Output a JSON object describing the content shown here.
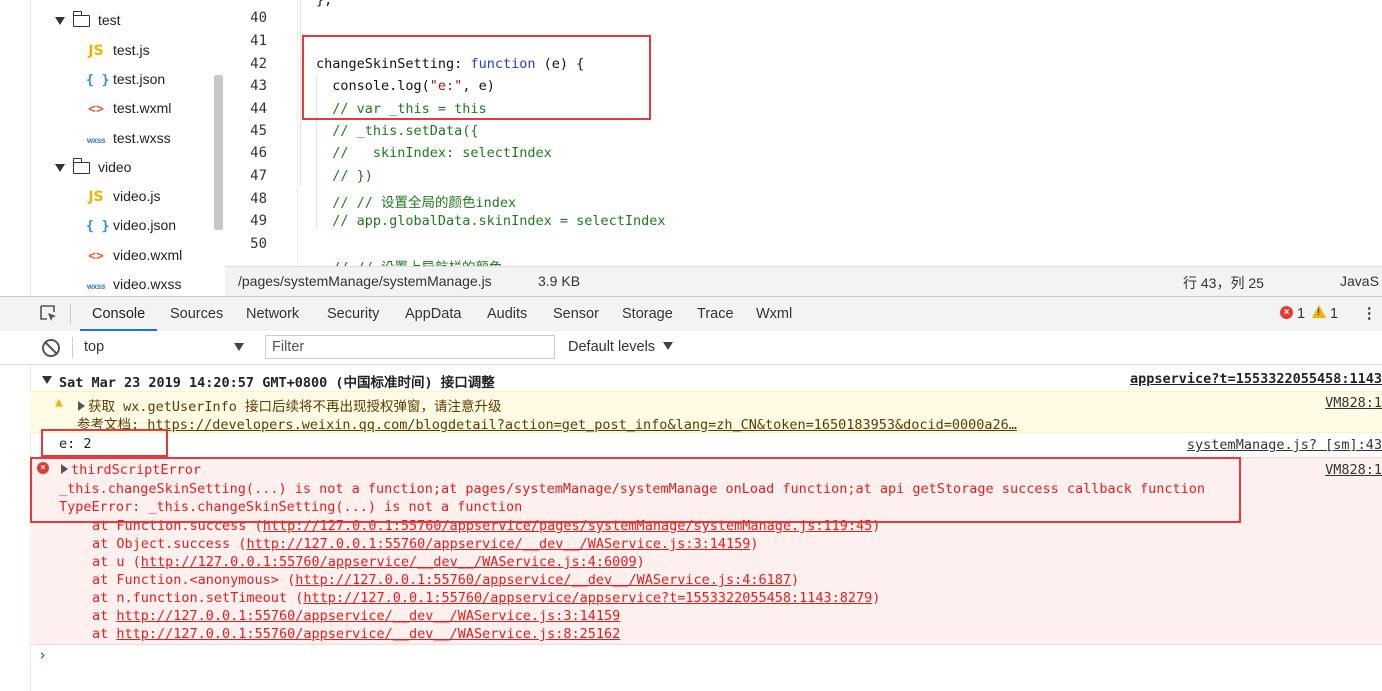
{
  "file_tree": {
    "items": [
      {
        "type": "folder",
        "label": "test"
      },
      {
        "type": "js",
        "icon": "JS",
        "label": "test.js"
      },
      {
        "type": "json",
        "icon": "{ }",
        "label": "test.json"
      },
      {
        "type": "wxml",
        "icon": "<>",
        "label": "test.wxml"
      },
      {
        "type": "wxss",
        "icon": "wxss",
        "label": "test.wxss"
      },
      {
        "type": "folder",
        "label": "video"
      },
      {
        "type": "js",
        "icon": "JS",
        "label": "video.js"
      },
      {
        "type": "json",
        "icon": "{ }",
        "label": "video.json"
      },
      {
        "type": "wxml",
        "icon": "<>",
        "label": "video.wxml"
      },
      {
        "type": "wxss",
        "icon": "wxss",
        "label": "video.wxss"
      }
    ]
  },
  "editor": {
    "line_numbers": [
      "40",
      "41",
      "42",
      "43",
      "44",
      "45",
      "46",
      "47",
      "48",
      "49",
      "50"
    ],
    "top_partial": "},"
  },
  "statusbar": {
    "path": "/pages/systemManage/systemManage.js",
    "size": "3.9 KB",
    "cursor": "行 43，列 25",
    "language": "JavaS"
  },
  "devtools": {
    "tabs": [
      "Console",
      "Sources",
      "Network",
      "Security",
      "AppData",
      "Audits",
      "Sensor",
      "Storage",
      "Trace",
      "Wxml"
    ],
    "active_tab": "Console",
    "error_count": "1",
    "warning_count": "1",
    "more_icon": "⋮"
  },
  "filter": {
    "context": "top",
    "placeholder": "Filter",
    "levels": "Default levels"
  },
  "console": {
    "group_header": "Sat Mar 23 2019 14:20:57 GMT+0800 (中国标准时间) 接口调整",
    "group_source": "appservice?t=1553322055458:1143",
    "warning_line1": "获取 wx.getUserInfo 接口后续将不再出现授权弹窗，请注意升级",
    "warning_line2_prefix": "参考文档: ",
    "warning_link": "https://developers.weixin.qq.com/blogdetail?action=get_post_info&lang=zh_CN&token=1650183953&docid=0000a26…",
    "warning_source": "VM828:1",
    "log_text": "e: 2",
    "log_source": "systemManage.js? [sm]:43",
    "error_title": "thirdScriptError",
    "error_source": "VM828:1",
    "error_line2": "_this.changeSkinSetting(...) is not a function;at pages/systemManage/systemManage onLoad function;at api getStorage success callback function",
    "error_line3": "TypeError: _this.changeSkinSetting(...) is not a function",
    "stack": [
      {
        "prefix": "at Function.success (",
        "url": "http://127.0.0.1:55760/appservice/pages/systemManage/systemManage.js:119:45",
        "suffix": ")"
      },
      {
        "prefix": "at Object.success (",
        "url": "http://127.0.0.1:55760/appservice/__dev__/WAService.js:3:14159",
        "suffix": ")"
      },
      {
        "prefix": "at u (",
        "url": "http://127.0.0.1:55760/appservice/__dev__/WAService.js:4:6009",
        "suffix": ")"
      },
      {
        "prefix": "at Function.<anonymous> (",
        "url": "http://127.0.0.1:55760/appservice/__dev__/WAService.js:4:6187",
        "suffix": ")"
      },
      {
        "prefix": "at n.function.setTimeout (",
        "url": "http://127.0.0.1:55760/appservice/appservice?t=1553322055458:1143:8279",
        "suffix": ")"
      },
      {
        "prefix": "at ",
        "url": "http://127.0.0.1:55760/appservice/__dev__/WAService.js:3:14159",
        "suffix": ""
      },
      {
        "prefix": "at ",
        "url": "http://127.0.0.1:55760/appservice/__dev__/WAService.js:8:25162",
        "suffix": ""
      }
    ],
    "prompt": "›"
  },
  "colors": {
    "annotation_box": "#e53a3a",
    "error_text": "#e0201f",
    "active_tab": "#1a73e8"
  }
}
